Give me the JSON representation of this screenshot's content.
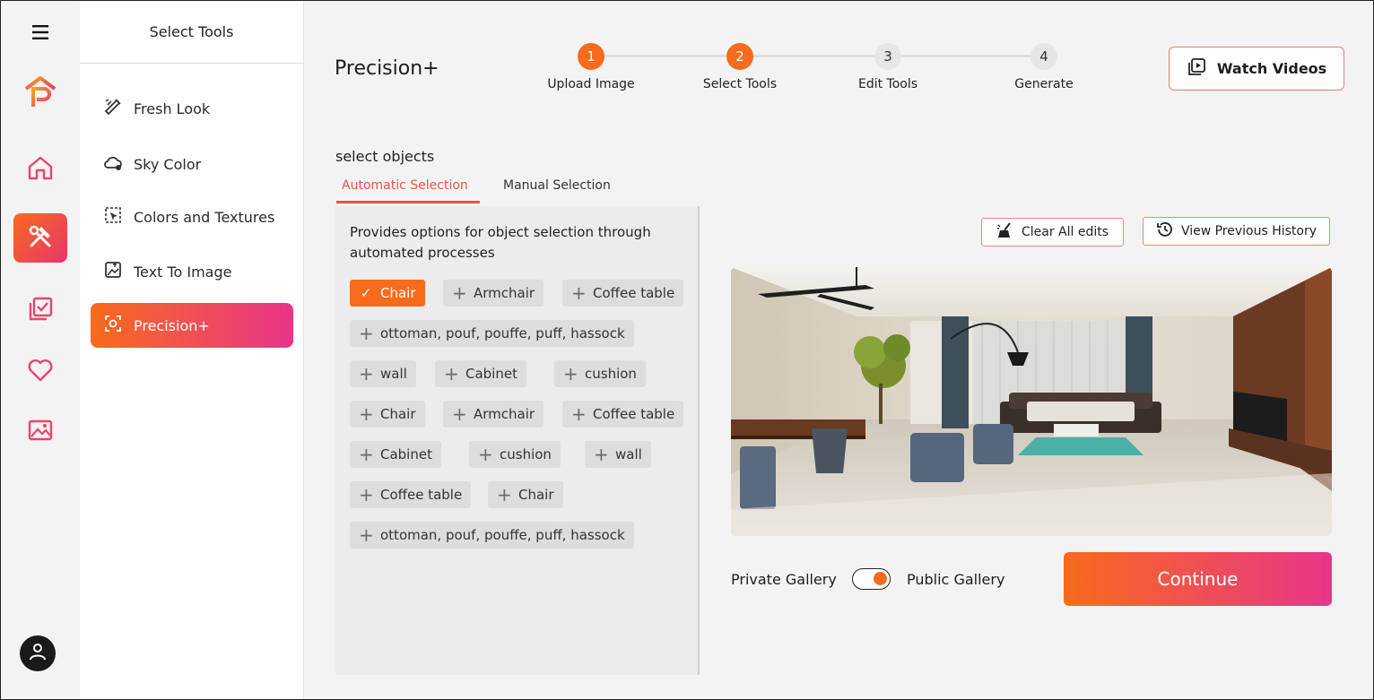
{
  "rail": {
    "menu_icon": "hamburger-icon",
    "logo_icon": "logo-icon",
    "items": [
      {
        "icon": "home-icon",
        "active": false
      },
      {
        "icon": "tools-icon",
        "active": true
      },
      {
        "icon": "checklist-icon",
        "active": false
      },
      {
        "icon": "heart-icon",
        "active": false
      },
      {
        "icon": "image-icon",
        "active": false
      }
    ],
    "avatar_icon": "user-icon"
  },
  "tools_panel": {
    "title": "Select Tools",
    "items": [
      {
        "label": "Fresh Look",
        "icon": "brush-icon",
        "active": false
      },
      {
        "label": "Sky Color",
        "icon": "cloud-icon",
        "active": false
      },
      {
        "label": "Colors and Textures",
        "icon": "selection-icon",
        "active": false
      },
      {
        "label": "Text To Image",
        "icon": "text-image-icon",
        "active": false
      },
      {
        "label": "Precision+",
        "icon": "focus-icon",
        "active": true
      }
    ]
  },
  "header": {
    "title": "Precision+",
    "steps": [
      {
        "number": "1",
        "label": "Upload Image",
        "done": true
      },
      {
        "number": "2",
        "label": "Select Tools",
        "done": true
      },
      {
        "number": "3",
        "label": "Edit Tools",
        "done": false
      },
      {
        "number": "4",
        "label": "Generate",
        "done": false
      }
    ],
    "watch_button": "Watch Videos"
  },
  "selection": {
    "heading": "select objects",
    "tabs": [
      {
        "label": "Automatic Selection",
        "active": true
      },
      {
        "label": "Manual Selection",
        "active": false
      }
    ],
    "description": "Provides options for object selection through automated processes",
    "chips": [
      {
        "label": "Chair",
        "selected": true
      },
      {
        "label": "Armchair",
        "selected": false
      },
      {
        "label": "Coffee table",
        "selected": false
      },
      {
        "label": "ottoman, pouf, pouffe, puff, hassock",
        "selected": false
      },
      {
        "label": "wall",
        "selected": false
      },
      {
        "label": "Cabinet",
        "selected": false
      },
      {
        "label": "cushion",
        "selected": false
      },
      {
        "label": "Chair",
        "selected": false
      },
      {
        "label": "Armchair",
        "selected": false
      },
      {
        "label": "Coffee table",
        "selected": false
      },
      {
        "label": "Cabinet",
        "selected": false
      },
      {
        "label": "cushion",
        "selected": false
      },
      {
        "label": "wall",
        "selected": false
      },
      {
        "label": "Coffee table",
        "selected": false
      },
      {
        "label": "Chair",
        "selected": false
      },
      {
        "label": "ottoman, pouf, pouffe, puff, hassock",
        "selected": false
      }
    ]
  },
  "preview": {
    "clear_button": "Clear All edits",
    "history_button": "View Previous History"
  },
  "footer": {
    "private_label": "Private Gallery",
    "public_label": "Public Gallery",
    "toggle_on": true,
    "continue_button": "Continue"
  },
  "colors": {
    "accent_orange": "#f76b1c",
    "accent_pink": "#e8358a",
    "tab_active": "#e8544a"
  }
}
